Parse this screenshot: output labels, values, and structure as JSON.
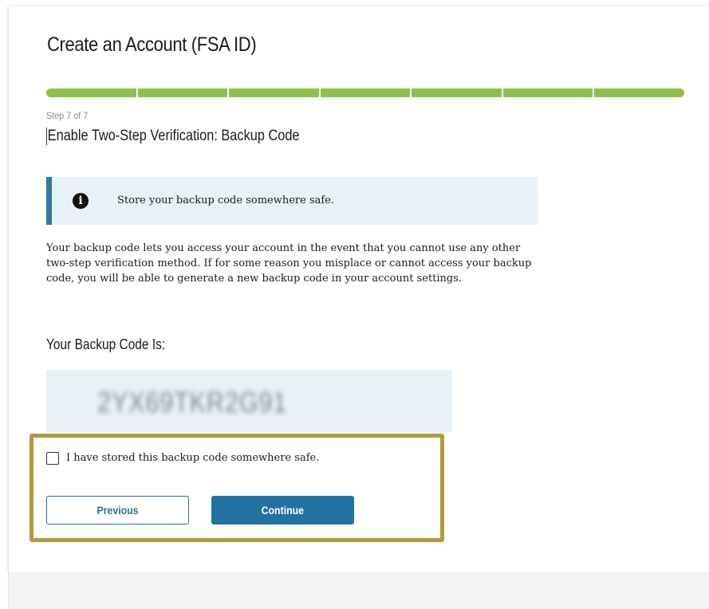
{
  "header": {
    "title": "Create an Account (FSA ID)"
  },
  "progress": {
    "current_step": 7,
    "total_steps": 7,
    "step_label": "Step 7 of 7",
    "color": "#8bc34a"
  },
  "step": {
    "title": "Enable Two-Step Verification: Backup Code"
  },
  "alert": {
    "icon": "info-icon",
    "text": "Store your backup code somewhere safe.",
    "accent": "#2d7aa6"
  },
  "description": "Your backup code lets you access your account in the event that you cannot use any other two-step verification method. If for some reason you misplace or cannot access your backup code, you will be able to generate a new backup code in your account settings.",
  "backup_code": {
    "heading": "Your Backup Code Is:",
    "value": "2YX69TKR2G91"
  },
  "confirm": {
    "label": "I have stored this backup code somewhere safe.",
    "checked": false
  },
  "buttons": {
    "previous": "Previous",
    "continue": "Continue"
  },
  "colors": {
    "highlight_border": "#b8963a",
    "primary": "#2373a0"
  }
}
